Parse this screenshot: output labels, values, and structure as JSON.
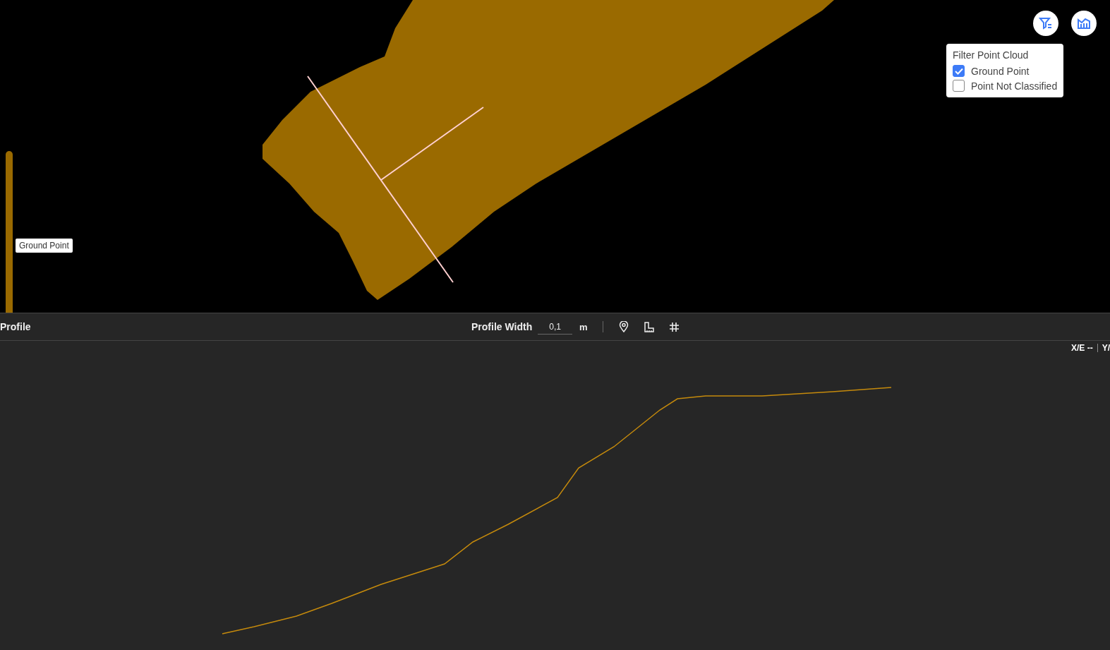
{
  "filter_panel": {
    "title": "Filter Point Cloud",
    "options": [
      {
        "label": "Ground Point",
        "checked": true
      },
      {
        "label": "Point Not Classified",
        "checked": false
      }
    ]
  },
  "legend": {
    "label": "Ground Point"
  },
  "profile_bar": {
    "title": "Profile",
    "width_label": "Profile Width",
    "width_value": "0,1",
    "unit": "m"
  },
  "coordinates": [
    {
      "label": "X/E",
      "value": "--"
    },
    {
      "label": "Y/"
    }
  ]
}
